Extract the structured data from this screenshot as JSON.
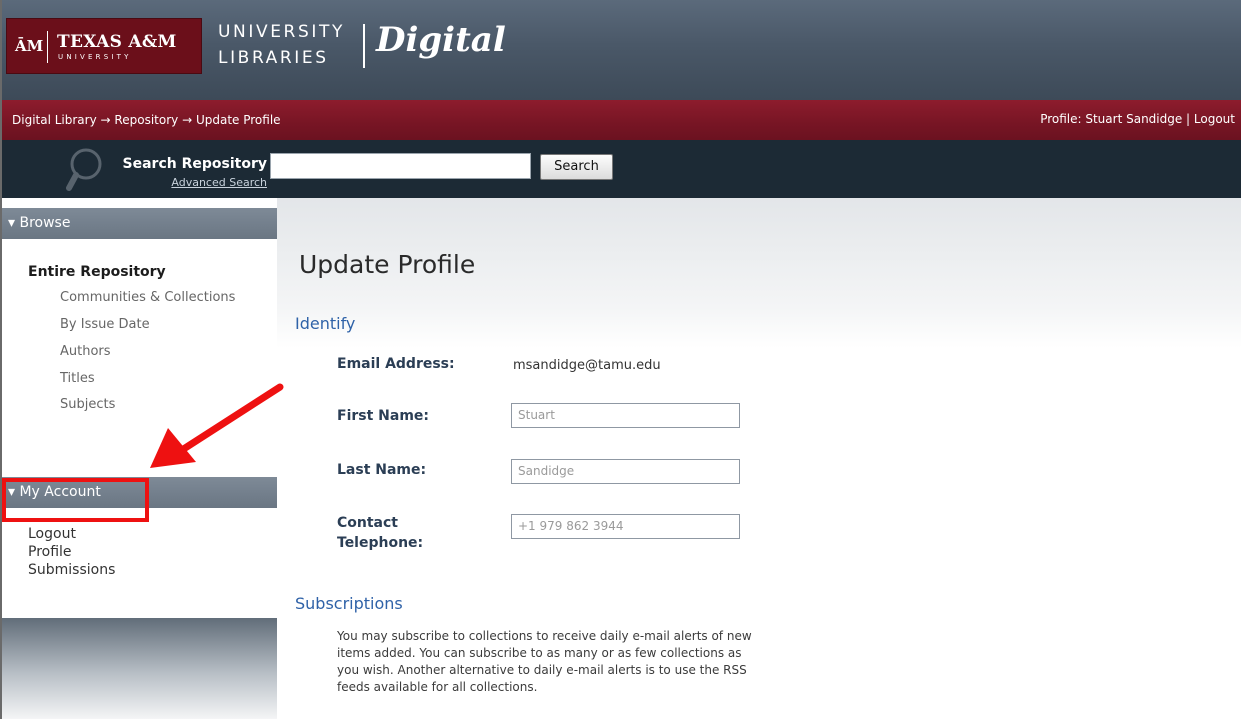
{
  "header": {
    "logo_mark": "ĀM",
    "logo_texas": "TEXAS A&M",
    "logo_university": "UNIVERSITY",
    "brand_university": "UNIVERSITY",
    "brand_libraries": "LIBRARIES",
    "brand_digital": "Digital"
  },
  "breadcrumb": {
    "items": [
      "Digital Library",
      "Repository",
      "Update Profile"
    ],
    "separator": "→"
  },
  "user": {
    "label": "Profile: Stuart Sandidge | Logout"
  },
  "search": {
    "label": "Search Repository",
    "advanced": "Advanced Search",
    "value": "",
    "button": "Search"
  },
  "sidebar": {
    "browse_heading": "▾ Browse",
    "entire": "Entire Repository",
    "browse_links": [
      "Communities & Collections",
      "By Issue Date",
      "Authors",
      "Titles",
      "Subjects"
    ],
    "account_heading": "▾ My Account",
    "account_links": [
      "Logout",
      "Profile",
      "Submissions"
    ]
  },
  "main": {
    "title": "Update Profile",
    "identify_heading": "Identify",
    "email_label": "Email Address:",
    "email_value": "msandidge@tamu.edu",
    "first_label": "First Name:",
    "first_value": "Stuart",
    "last_label": "Last Name:",
    "last_value": "Sandidge",
    "phone_label_1": "Contact",
    "phone_label_2": "Telephone:",
    "phone_value": "+1 979 862 3944",
    "subscriptions_heading": "Subscriptions",
    "subscriptions_text": "You may subscribe to collections to receive daily e-mail alerts of new items added. You can subscribe to as many or as few collections as you wish. Another alternative to daily e-mail alerts is to use the RSS feeds available for all collections."
  },
  "colors": {
    "maroon": "#6b0f1a",
    "banner": "#4a5868",
    "search_bar": "#1c2a35",
    "section_blue": "#2f62a8",
    "annotation_red": "#ee1111"
  }
}
